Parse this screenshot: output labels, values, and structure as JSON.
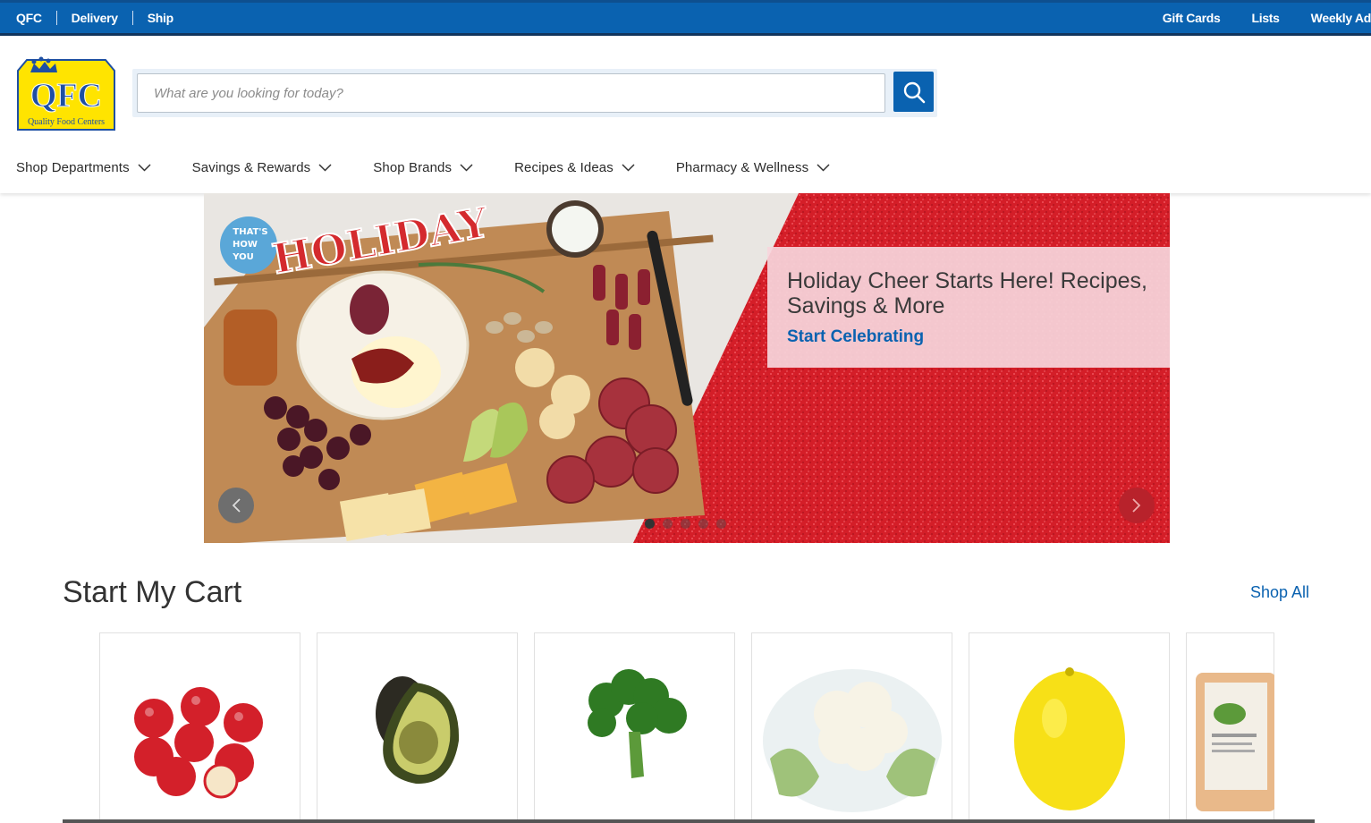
{
  "topbar": {
    "left_links": [
      "QFC",
      "Delivery",
      "Ship"
    ],
    "right_links": [
      "Gift Cards",
      "Lists",
      "Weekly Ad"
    ]
  },
  "logo": {
    "main": "QFC",
    "sub": "Quality Food Centers"
  },
  "search": {
    "placeholder": "What are you looking for today?",
    "value": ""
  },
  "nav": {
    "items": [
      {
        "label": "Shop Departments"
      },
      {
        "label": "Savings & Rewards"
      },
      {
        "label": "Shop Brands"
      },
      {
        "label": "Recipes & Ideas"
      },
      {
        "label": "Pharmacy & Wellness"
      }
    ]
  },
  "hero": {
    "badge_small": [
      "THAT'S",
      "HOW",
      "YOU"
    ],
    "badge_big": "HOLIDAY",
    "title": "Holiday Cheer Starts Here! Recipes, Savings & More",
    "cta": "Start Celebrating",
    "slide_count": 5,
    "active_slide": 1
  },
  "cart_section": {
    "title": "Start My Cart",
    "shop_all": "Shop All",
    "products": [
      {
        "icon": "apples-image"
      },
      {
        "icon": "avocado-image"
      },
      {
        "icon": "broccoli-image"
      },
      {
        "icon": "cauliflower-image"
      },
      {
        "icon": "lemon-image"
      },
      {
        "icon": "chicken-package-image"
      }
    ]
  },
  "colors": {
    "brand_blue": "#0a62b0",
    "logo_yellow": "#ffe400",
    "hero_red": "#d8202a"
  }
}
